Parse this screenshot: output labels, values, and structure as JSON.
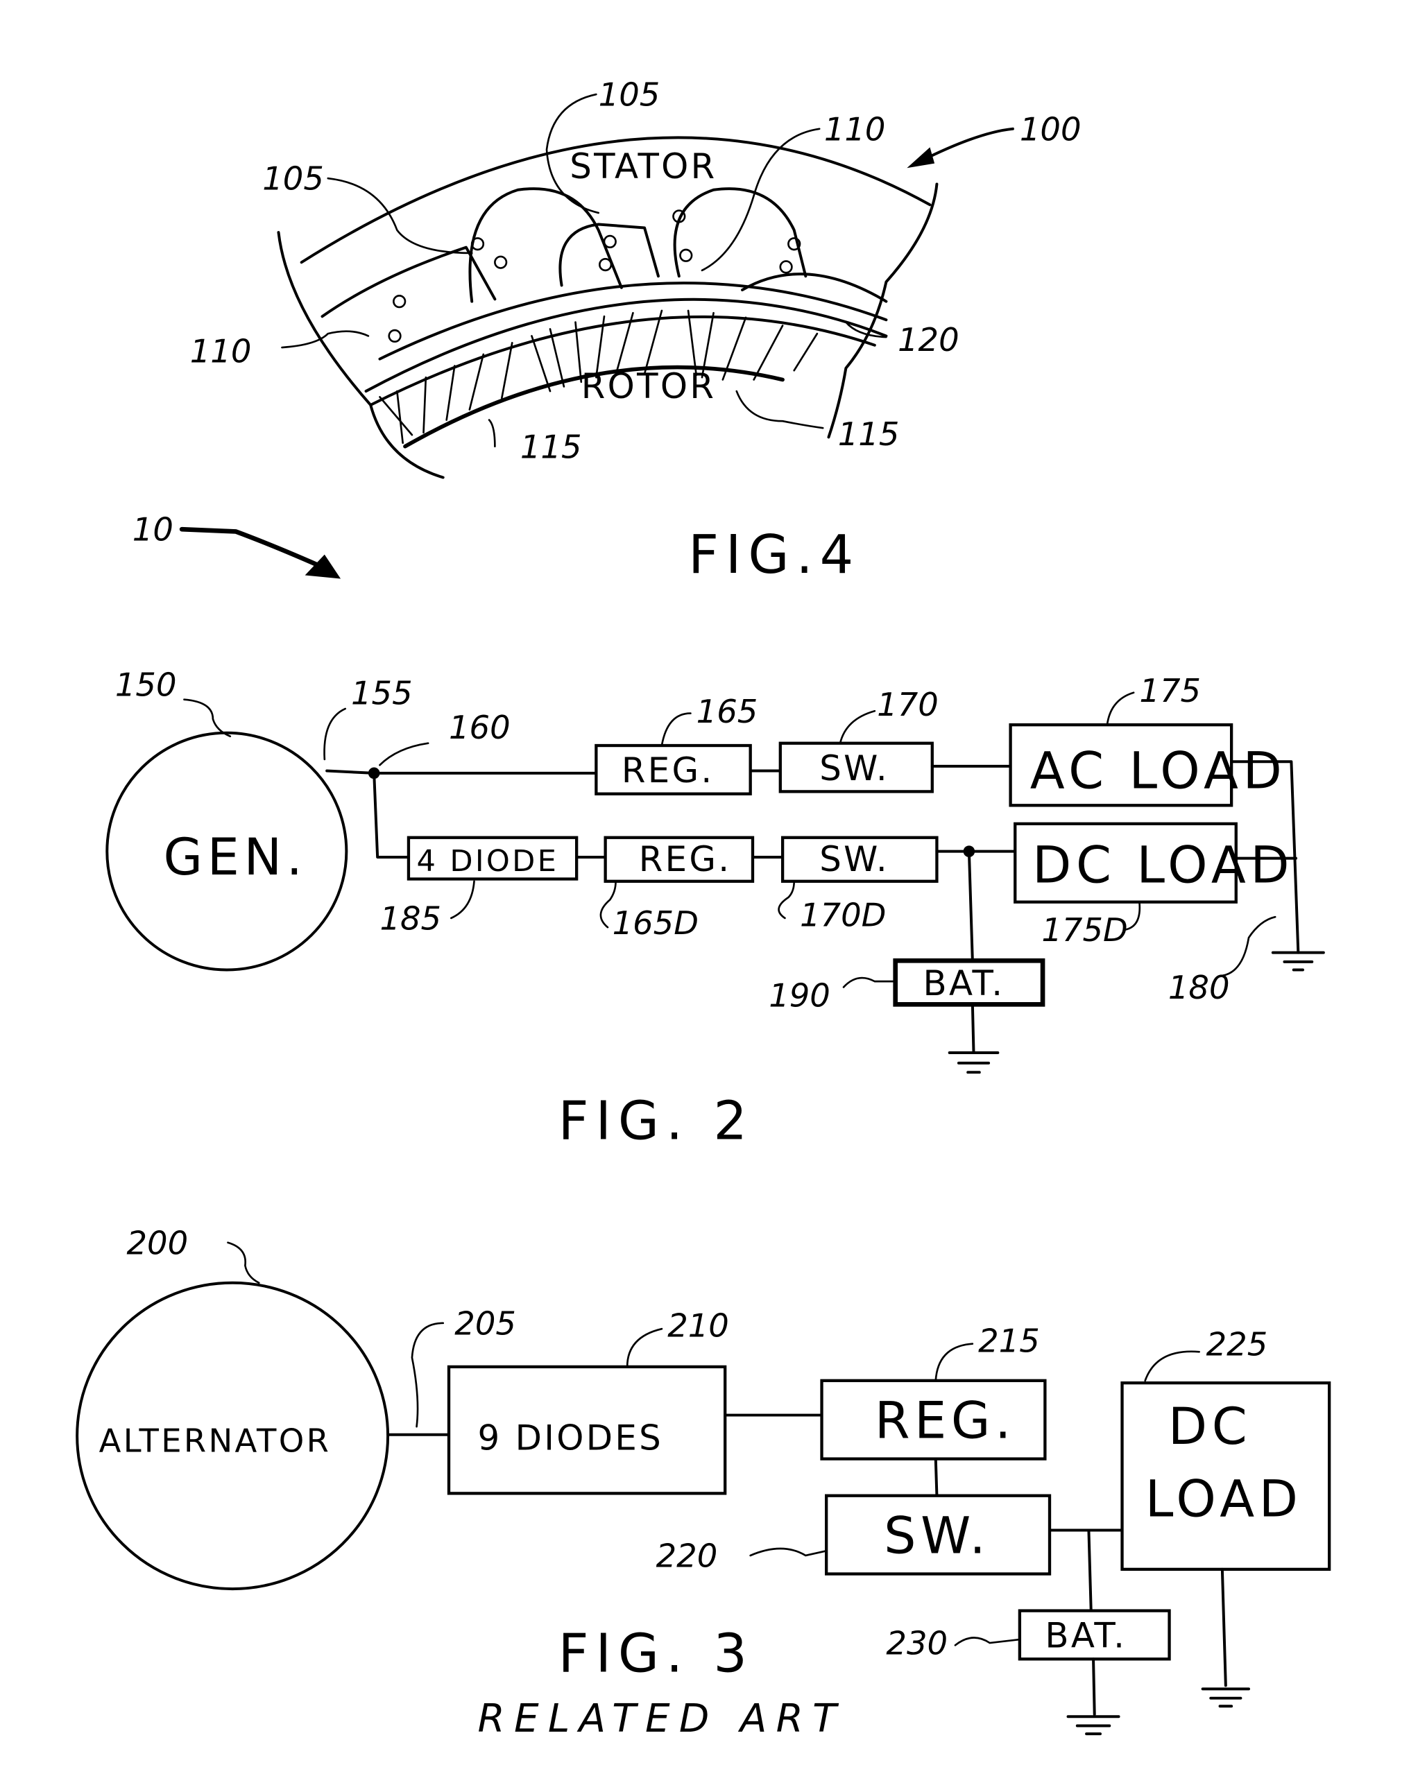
{
  "figures": {
    "fig4": {
      "caption": "FIG.4",
      "ref_main": "100",
      "stator_label": "STATOR",
      "rotor_label": "ROTOR",
      "refs": {
        "coil_left": "105",
        "coil_top": "105",
        "wire_top": "110",
        "wire_left": "110",
        "gap": "120",
        "magnet_left": "115",
        "magnet_right": "115"
      }
    },
    "fig2": {
      "caption": "FIG. 2",
      "system_ref": "10",
      "generator": {
        "label": "GEN.",
        "ref": "150"
      },
      "output_line_ref": "155",
      "node_ref": "160",
      "ac_branch": {
        "regulator": {
          "label": "REG.",
          "ref": "165"
        },
        "switch": {
          "label": "SW.",
          "ref": "170"
        },
        "load": {
          "label": "AC LOAD",
          "ref": "175"
        }
      },
      "dc_branch": {
        "rectifier": {
          "label": "4 DIODE",
          "ref": "185"
        },
        "regulator": {
          "label": "REG.",
          "ref": "165D"
        },
        "switch": {
          "label": "SW.",
          "ref": "170D"
        },
        "load": {
          "label": "DC LOAD",
          "ref": "175D"
        },
        "battery": {
          "label": "BAT.",
          "ref": "190"
        }
      },
      "ground_ref": "180"
    },
    "fig3": {
      "caption": "FIG. 3",
      "subcaption": "RELATED ART",
      "alternator": {
        "label": "ALTERNATOR",
        "ref": "200"
      },
      "output_line_ref": "205",
      "rectifier": {
        "label": "9 DIODES",
        "ref": "210"
      },
      "regulator": {
        "label": "REG.",
        "ref": "215"
      },
      "switch": {
        "label": "SW.",
        "ref": "220"
      },
      "load": {
        "label_line1": "DC",
        "label_line2": "LOAD",
        "ref": "225"
      },
      "battery": {
        "label": "BAT.",
        "ref": "230"
      }
    }
  }
}
